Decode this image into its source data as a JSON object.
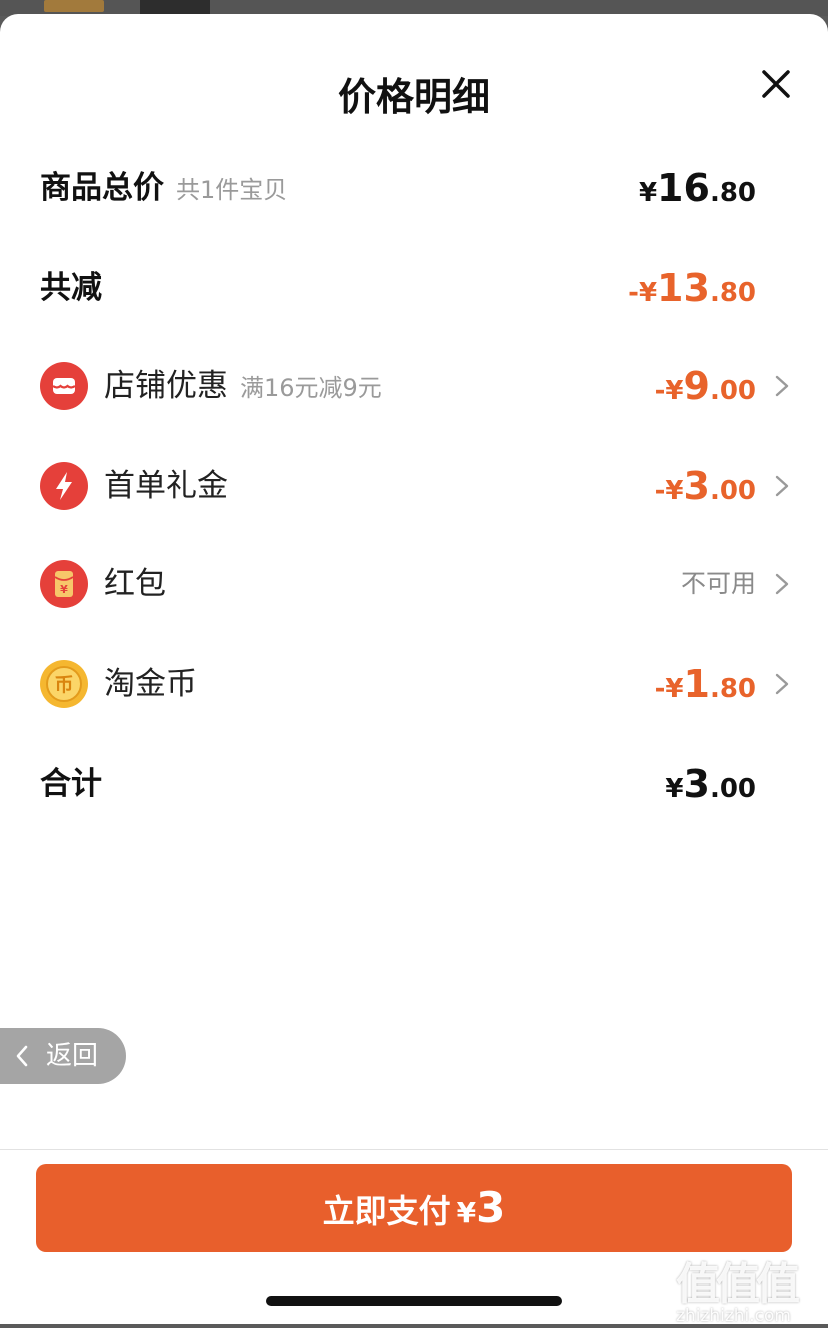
{
  "sheet": {
    "title": "价格明细"
  },
  "summary": {
    "subtotal": {
      "label": "商品总价",
      "note": "共1件宝贝",
      "currency": "¥",
      "int": "16",
      "dec": ".80"
    },
    "discount": {
      "label": "共减",
      "currency": "-¥",
      "int": "13",
      "dec": ".80"
    }
  },
  "items": [
    {
      "label": "店铺优惠",
      "note": "满16元减9元",
      "currency": "-¥",
      "int": "9",
      "dec": ".00",
      "icon": "store-coupon-icon"
    },
    {
      "label": "首单礼金",
      "currency": "-¥",
      "int": "3",
      "dec": ".00",
      "icon": "lightning-icon"
    },
    {
      "label": "红包",
      "status": "不可用",
      "icon": "red-packet-icon",
      "icon_glyph": "¥"
    },
    {
      "label": "淘金币",
      "currency": "-¥",
      "int": "1",
      "dec": ".80",
      "icon": "gold-coin-icon",
      "icon_glyph": "币"
    }
  ],
  "total": {
    "label": "合计",
    "currency": "¥",
    "int": "3",
    "dec": ".00"
  },
  "back_button": {
    "label": "返回"
  },
  "pay_button": {
    "label": "立即支付",
    "currency": "¥",
    "amount": "3"
  },
  "watermark": {
    "big": "值值值",
    "small": "zhizhizhi.com"
  },
  "colors": {
    "accent": "#e8632b",
    "red_icon": "#e5403a",
    "coin": "#f5b730"
  }
}
